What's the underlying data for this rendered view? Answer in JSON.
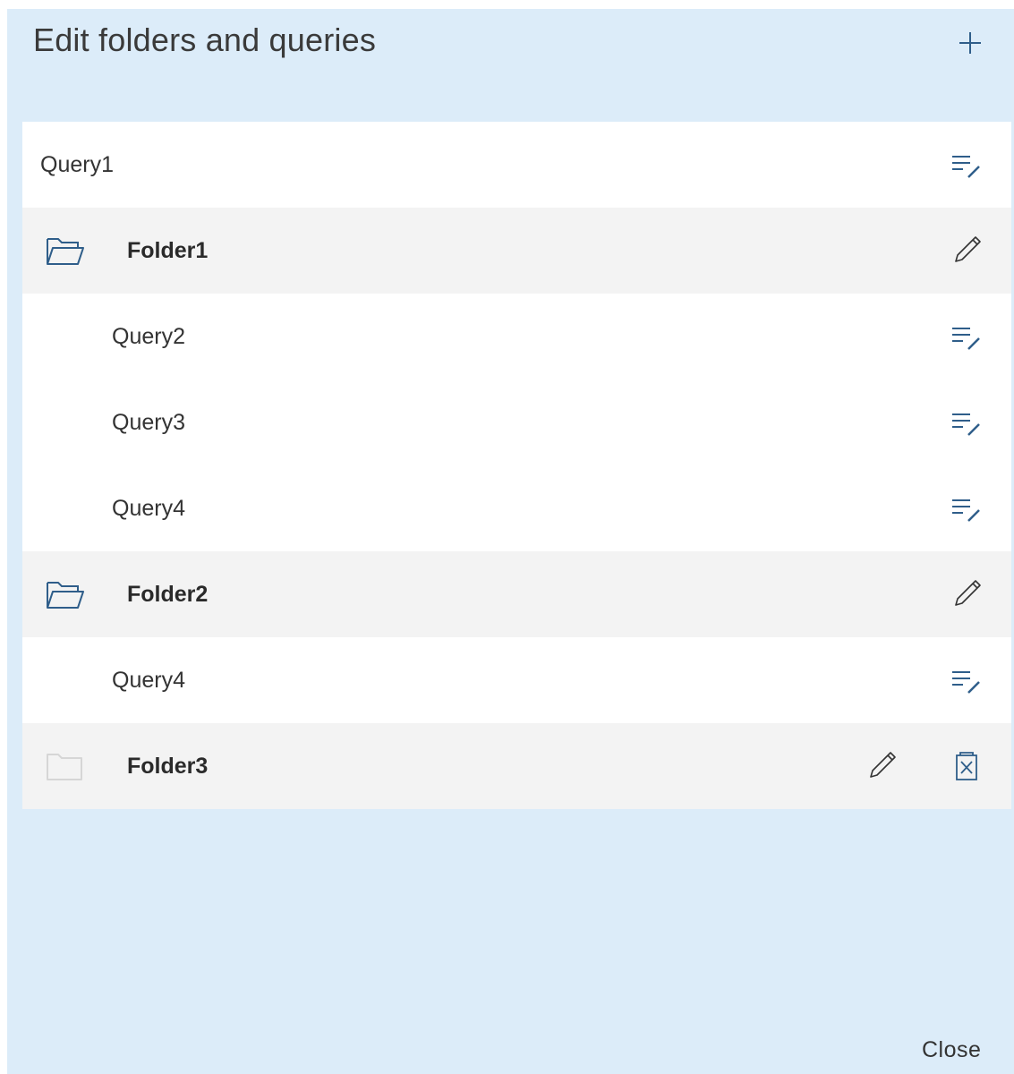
{
  "dialog": {
    "title": "Edit folders and queries",
    "close_label": "Close"
  },
  "icons": {
    "add": "plus-icon",
    "query_edit": "edit-query-icon",
    "folder_open": "folder-open-icon",
    "folder_empty": "folder-icon",
    "rename": "pencil-icon",
    "delete": "delete-icon"
  },
  "colors": {
    "panel_bg": "#dcecf9",
    "folder_row_bg": "#f3f3f3",
    "icon_accent": "#2f5e8a"
  },
  "items": [
    {
      "type": "query",
      "label": "Query1"
    },
    {
      "type": "folder",
      "label": "Folder1"
    },
    {
      "type": "query",
      "label": "Query2"
    },
    {
      "type": "query",
      "label": "Query3"
    },
    {
      "type": "query",
      "label": "Query4"
    },
    {
      "type": "folder",
      "label": "Folder2"
    },
    {
      "type": "query",
      "label": "Query4"
    },
    {
      "type": "folder",
      "label": "Folder3"
    }
  ]
}
